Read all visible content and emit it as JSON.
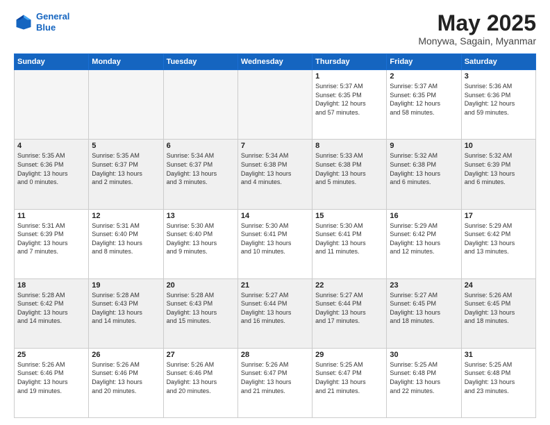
{
  "header": {
    "logo_line1": "General",
    "logo_line2": "Blue",
    "month": "May 2025",
    "location": "Monywa, Sagain, Myanmar"
  },
  "days_of_week": [
    "Sunday",
    "Monday",
    "Tuesday",
    "Wednesday",
    "Thursday",
    "Friday",
    "Saturday"
  ],
  "weeks": [
    [
      {
        "num": "",
        "empty": true
      },
      {
        "num": "",
        "empty": true
      },
      {
        "num": "",
        "empty": true
      },
      {
        "num": "",
        "empty": true
      },
      {
        "num": "1",
        "line1": "Sunrise: 5:37 AM",
        "line2": "Sunset: 6:35 PM",
        "line3": "Daylight: 12 hours",
        "line4": "and 57 minutes."
      },
      {
        "num": "2",
        "line1": "Sunrise: 5:37 AM",
        "line2": "Sunset: 6:35 PM",
        "line3": "Daylight: 12 hours",
        "line4": "and 58 minutes."
      },
      {
        "num": "3",
        "line1": "Sunrise: 5:36 AM",
        "line2": "Sunset: 6:36 PM",
        "line3": "Daylight: 12 hours",
        "line4": "and 59 minutes."
      }
    ],
    [
      {
        "num": "4",
        "line1": "Sunrise: 5:35 AM",
        "line2": "Sunset: 6:36 PM",
        "line3": "Daylight: 13 hours",
        "line4": "and 0 minutes."
      },
      {
        "num": "5",
        "line1": "Sunrise: 5:35 AM",
        "line2": "Sunset: 6:37 PM",
        "line3": "Daylight: 13 hours",
        "line4": "and 2 minutes."
      },
      {
        "num": "6",
        "line1": "Sunrise: 5:34 AM",
        "line2": "Sunset: 6:37 PM",
        "line3": "Daylight: 13 hours",
        "line4": "and 3 minutes."
      },
      {
        "num": "7",
        "line1": "Sunrise: 5:34 AM",
        "line2": "Sunset: 6:38 PM",
        "line3": "Daylight: 13 hours",
        "line4": "and 4 minutes."
      },
      {
        "num": "8",
        "line1": "Sunrise: 5:33 AM",
        "line2": "Sunset: 6:38 PM",
        "line3": "Daylight: 13 hours",
        "line4": "and 5 minutes."
      },
      {
        "num": "9",
        "line1": "Sunrise: 5:32 AM",
        "line2": "Sunset: 6:38 PM",
        "line3": "Daylight: 13 hours",
        "line4": "and 6 minutes."
      },
      {
        "num": "10",
        "line1": "Sunrise: 5:32 AM",
        "line2": "Sunset: 6:39 PM",
        "line3": "Daylight: 13 hours",
        "line4": "and 6 minutes."
      }
    ],
    [
      {
        "num": "11",
        "line1": "Sunrise: 5:31 AM",
        "line2": "Sunset: 6:39 PM",
        "line3": "Daylight: 13 hours",
        "line4": "and 7 minutes."
      },
      {
        "num": "12",
        "line1": "Sunrise: 5:31 AM",
        "line2": "Sunset: 6:40 PM",
        "line3": "Daylight: 13 hours",
        "line4": "and 8 minutes."
      },
      {
        "num": "13",
        "line1": "Sunrise: 5:30 AM",
        "line2": "Sunset: 6:40 PM",
        "line3": "Daylight: 13 hours",
        "line4": "and 9 minutes."
      },
      {
        "num": "14",
        "line1": "Sunrise: 5:30 AM",
        "line2": "Sunset: 6:41 PM",
        "line3": "Daylight: 13 hours",
        "line4": "and 10 minutes."
      },
      {
        "num": "15",
        "line1": "Sunrise: 5:30 AM",
        "line2": "Sunset: 6:41 PM",
        "line3": "Daylight: 13 hours",
        "line4": "and 11 minutes."
      },
      {
        "num": "16",
        "line1": "Sunrise: 5:29 AM",
        "line2": "Sunset: 6:42 PM",
        "line3": "Daylight: 13 hours",
        "line4": "and 12 minutes."
      },
      {
        "num": "17",
        "line1": "Sunrise: 5:29 AM",
        "line2": "Sunset: 6:42 PM",
        "line3": "Daylight: 13 hours",
        "line4": "and 13 minutes."
      }
    ],
    [
      {
        "num": "18",
        "line1": "Sunrise: 5:28 AM",
        "line2": "Sunset: 6:42 PM",
        "line3": "Daylight: 13 hours",
        "line4": "and 14 minutes."
      },
      {
        "num": "19",
        "line1": "Sunrise: 5:28 AM",
        "line2": "Sunset: 6:43 PM",
        "line3": "Daylight: 13 hours",
        "line4": "and 14 minutes."
      },
      {
        "num": "20",
        "line1": "Sunrise: 5:28 AM",
        "line2": "Sunset: 6:43 PM",
        "line3": "Daylight: 13 hours",
        "line4": "and 15 minutes."
      },
      {
        "num": "21",
        "line1": "Sunrise: 5:27 AM",
        "line2": "Sunset: 6:44 PM",
        "line3": "Daylight: 13 hours",
        "line4": "and 16 minutes."
      },
      {
        "num": "22",
        "line1": "Sunrise: 5:27 AM",
        "line2": "Sunset: 6:44 PM",
        "line3": "Daylight: 13 hours",
        "line4": "and 17 minutes."
      },
      {
        "num": "23",
        "line1": "Sunrise: 5:27 AM",
        "line2": "Sunset: 6:45 PM",
        "line3": "Daylight: 13 hours",
        "line4": "and 18 minutes."
      },
      {
        "num": "24",
        "line1": "Sunrise: 5:26 AM",
        "line2": "Sunset: 6:45 PM",
        "line3": "Daylight: 13 hours",
        "line4": "and 18 minutes."
      }
    ],
    [
      {
        "num": "25",
        "line1": "Sunrise: 5:26 AM",
        "line2": "Sunset: 6:46 PM",
        "line3": "Daylight: 13 hours",
        "line4": "and 19 minutes."
      },
      {
        "num": "26",
        "line1": "Sunrise: 5:26 AM",
        "line2": "Sunset: 6:46 PM",
        "line3": "Daylight: 13 hours",
        "line4": "and 20 minutes."
      },
      {
        "num": "27",
        "line1": "Sunrise: 5:26 AM",
        "line2": "Sunset: 6:46 PM",
        "line3": "Daylight: 13 hours",
        "line4": "and 20 minutes."
      },
      {
        "num": "28",
        "line1": "Sunrise: 5:26 AM",
        "line2": "Sunset: 6:47 PM",
        "line3": "Daylight: 13 hours",
        "line4": "and 21 minutes."
      },
      {
        "num": "29",
        "line1": "Sunrise: 5:25 AM",
        "line2": "Sunset: 6:47 PM",
        "line3": "Daylight: 13 hours",
        "line4": "and 21 minutes."
      },
      {
        "num": "30",
        "line1": "Sunrise: 5:25 AM",
        "line2": "Sunset: 6:48 PM",
        "line3": "Daylight: 13 hours",
        "line4": "and 22 minutes."
      },
      {
        "num": "31",
        "line1": "Sunrise: 5:25 AM",
        "line2": "Sunset: 6:48 PM",
        "line3": "Daylight: 13 hours",
        "line4": "and 23 minutes."
      }
    ]
  ]
}
